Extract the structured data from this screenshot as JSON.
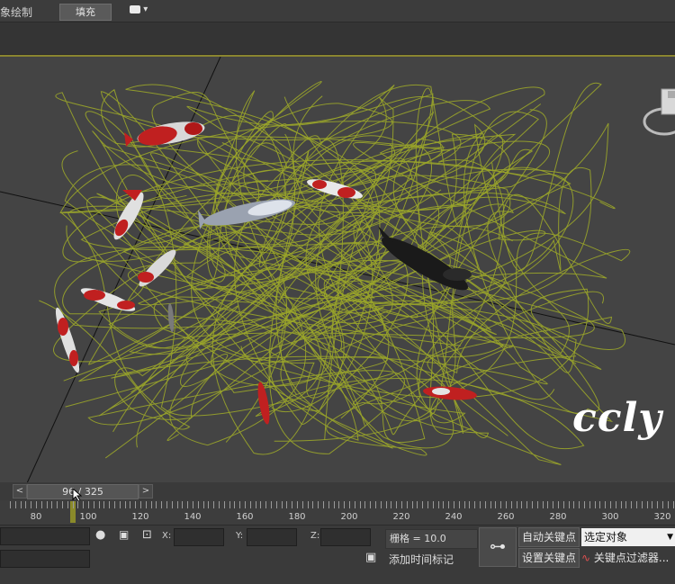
{
  "ribbon": {
    "object_paint_label": "象绘制",
    "fill_button": "填充",
    "dropdown_arrow": "▾"
  },
  "viewport": {
    "watermark": "ccly",
    "viewcube": "viewcube-icon"
  },
  "time_slider": {
    "prev": "<",
    "next": ">",
    "frame_readout": "96 / 325",
    "current_frame": 96,
    "total_frames": 325
  },
  "track_ruler": {
    "labels": [
      "80",
      "100",
      "120",
      "140",
      "160",
      "180",
      "200",
      "220",
      "240",
      "260",
      "280",
      "300",
      "320"
    ]
  },
  "status_bar": {
    "x_label": "X:",
    "y_label": "Y:",
    "z_label": "Z:",
    "x_value": "",
    "y_value": "",
    "z_value": "",
    "grid_text": "栅格 = 10.0",
    "add_time_tag": "添加时间标记",
    "auto_key": "自动关键点",
    "set_key": "设置关键点",
    "selected_object": "选定对象",
    "key_filters": "关键点过滤器..."
  },
  "colors": {
    "path_curve": "#9aa52a",
    "viewport_bg": "#444444",
    "viewport_border": "#8a8530"
  }
}
